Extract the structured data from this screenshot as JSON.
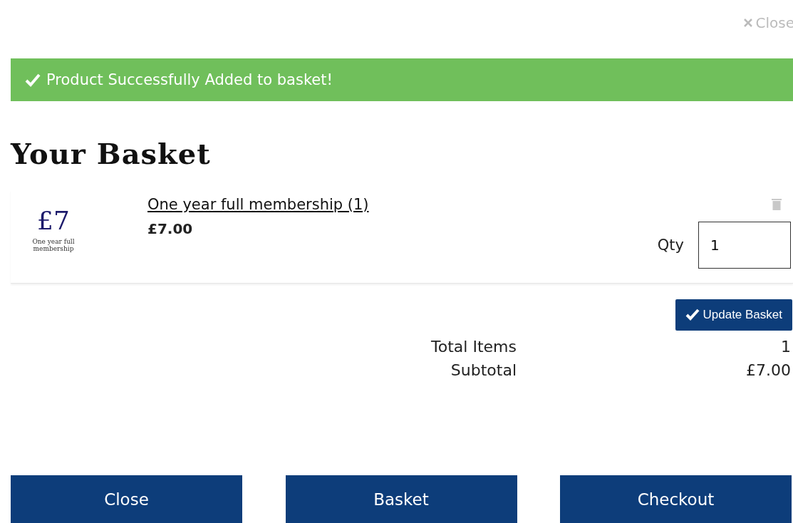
{
  "close_link": "Close",
  "alert": {
    "message": "Product Successfully Added to basket!"
  },
  "heading": "Your Basket",
  "items": [
    {
      "thumb_price": "£7",
      "thumb_caption": "One year full membership",
      "name": "One year full membership (1)",
      "price": "£7.00",
      "qty_label": "Qty",
      "qty": "1"
    }
  ],
  "update_button": "Update Basket",
  "totals": [
    {
      "label": "Total Items",
      "value": "1"
    },
    {
      "label": "Subtotal",
      "value": "£7.00"
    }
  ],
  "buttons": [
    "Close",
    "Basket",
    "Checkout"
  ]
}
